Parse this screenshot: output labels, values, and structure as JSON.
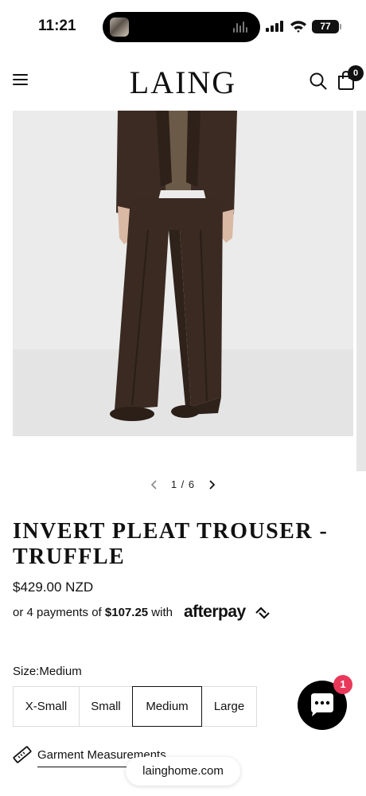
{
  "status_bar": {
    "time": "11:21",
    "battery": "77",
    "icons": [
      "now-playing-thumbnail",
      "audio-waveform-icon",
      "signal-icon",
      "wifi-icon",
      "battery-icon"
    ]
  },
  "header": {
    "logo": "LAING",
    "icons": [
      "menu-icon",
      "search-icon",
      "cart-icon"
    ],
    "cart_count": "0"
  },
  "gallery": {
    "current": 1,
    "total": 6,
    "indicator": "1 / 6",
    "image_background": "#ebebeb",
    "garment_color": "#3a2a21"
  },
  "product": {
    "title": "INVERT PLEAT TROUSER - TRUFFLE",
    "price": "$429.00 NZD",
    "afterpay": {
      "prefix": "or 4 payments of ",
      "amount": "$107.25",
      "suffix": " with",
      "brand": "afterpay"
    },
    "size_label": "Size:",
    "size_value": "Medium",
    "sizes": [
      "X-Small",
      "Small",
      "Medium",
      "Large"
    ],
    "selected_size": "Medium",
    "measurements_link": "Garment Measurements"
  },
  "chat": {
    "badge": "1",
    "button_color": "#000000",
    "badge_color": "#e8385a"
  },
  "browser": {
    "url": "lainghome.com"
  }
}
